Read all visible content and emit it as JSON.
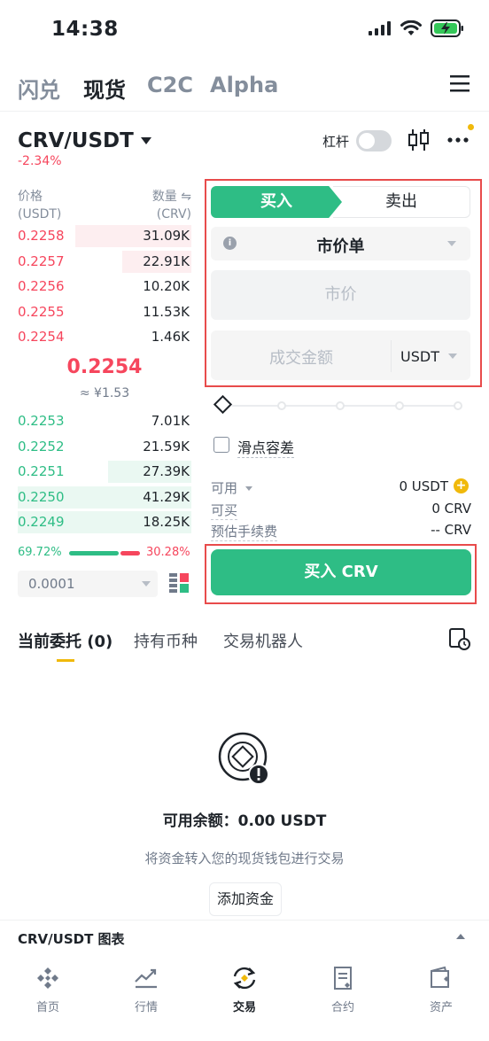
{
  "status_bar": {
    "time": "14:38"
  },
  "nav": {
    "tabs": [
      {
        "label": "闪兑",
        "active": false
      },
      {
        "label": "现货",
        "active": true
      },
      {
        "label": "C2C",
        "active": false
      },
      {
        "label": "Alpha",
        "active": false
      }
    ]
  },
  "pair": {
    "symbol": "CRV/USDT",
    "change": "-2.34%",
    "leverage_label": "杠杆",
    "leverage_on": false
  },
  "orderbook": {
    "price_header": "价格",
    "price_unit": "(USDT)",
    "qty_header": "数量 ⇋",
    "qty_unit": "(CRV)",
    "asks": [
      {
        "price": "0.2258",
        "qty": "31.09K",
        "depth": 0.67
      },
      {
        "price": "0.2257",
        "qty": "22.91K",
        "depth": 0.4
      },
      {
        "price": "0.2256",
        "qty": "10.20K",
        "depth": 0
      },
      {
        "price": "0.2255",
        "qty": "11.53K",
        "depth": 0
      },
      {
        "price": "0.2254",
        "qty": "1.46K",
        "depth": 0
      }
    ],
    "last_price": "0.2254",
    "last_price_cny": "≈ ¥1.53",
    "bids": [
      {
        "price": "0.2253",
        "qty": "7.01K",
        "depth": 0
      },
      {
        "price": "0.2252",
        "qty": "21.59K",
        "depth": 0
      },
      {
        "price": "0.2251",
        "qty": "27.39K",
        "depth": 0.48
      },
      {
        "price": "0.2250",
        "qty": "41.29K",
        "depth": 1.0
      },
      {
        "price": "0.2249",
        "qty": "18.25K",
        "depth": 1.0
      }
    ],
    "buy_ratio": "69.72%",
    "sell_ratio": "30.28%",
    "precision": "0.0001"
  },
  "form": {
    "buy_tab": "买入",
    "sell_tab": "卖出",
    "order_type": "市价单",
    "price_placeholder": "市价",
    "amount_placeholder": "成交金额",
    "amount_unit": "USDT",
    "slippage_label": "滑点容差",
    "available_label": "可用",
    "available_value": "0 USDT",
    "can_buy_label": "可买",
    "can_buy_value": "0 CRV",
    "fee_label": "预估手续费",
    "fee_value": "-- CRV",
    "buy_button": "买入 CRV"
  },
  "orders": {
    "tabs": [
      {
        "label": "当前委托 (0)",
        "active": true
      },
      {
        "label": "持有币种",
        "active": false
      },
      {
        "label": "交易机器人",
        "active": false
      }
    ],
    "balance_text": "可用余额：0.00 USDT",
    "hint": "将资金转入您的现货钱包进行交易",
    "add_funds": "添加资金"
  },
  "chart_bar": {
    "label": "CRV/USDT 图表"
  },
  "tabbar": [
    {
      "label": "首页",
      "icon": "home-icon",
      "active": false
    },
    {
      "label": "行情",
      "icon": "markets-icon",
      "active": false
    },
    {
      "label": "交易",
      "icon": "trade-icon",
      "active": true
    },
    {
      "label": "合约",
      "icon": "futures-icon",
      "active": false
    },
    {
      "label": "资产",
      "icon": "wallet-icon",
      "active": false
    }
  ],
  "colors": {
    "buy": "#2ebd85",
    "sell": "#f6465d",
    "accent": "#f0b90b",
    "highlight_box": "#e84b4b"
  }
}
